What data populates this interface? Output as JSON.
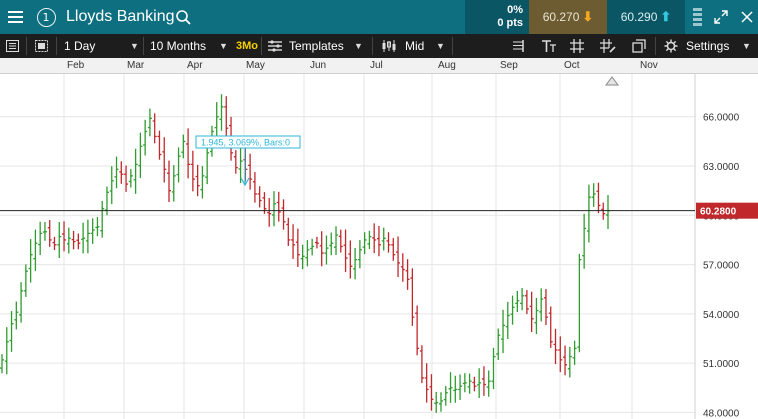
{
  "header": {
    "window_number": "1",
    "instrument_name": "Lloyds Banking",
    "change_percent": "0%",
    "change_points": "0 pts",
    "sell_price": "60.270",
    "buy_price": "60.290"
  },
  "toolbar": {
    "interval": "1 Day",
    "range": "10 Months",
    "preset_3mo": "3Mo",
    "templates": "Templates",
    "price_type": "Mid",
    "settings": "Settings"
  },
  "icons": {
    "menu": "menu-icon",
    "window_number": "circle-number-icon",
    "search": "search-icon",
    "sell_arrow": "arrow-down-icon",
    "buy_arrow": "arrow-up-icon",
    "drag": "grip-icon",
    "expand": "expand-icon",
    "close": "close-icon",
    "panel": "panel-icon",
    "layout": "layout-icon",
    "templates": "chart-tools-icon",
    "candles": "candles-icon",
    "trendline": "drawing-icon",
    "text": "text-icon",
    "crosshair": "crosshair-icon",
    "drawing_tools": "drawing-tools-icon",
    "popout": "popout-icon",
    "settings": "gear-icon"
  },
  "colors": {
    "header_bg": "#0e6f80",
    "sell_bg": "#6d5b32",
    "buy_bg": "#0b5665",
    "up_bar": "#2e9c2e",
    "down_bar": "#c0282b",
    "measure": "#2cb7d9",
    "price_label_bg": "#c0282b"
  },
  "chart_data": {
    "type": "ohlc",
    "x_axis_months": [
      "Feb",
      "Mar",
      "Apr",
      "May",
      "Jun",
      "Jul",
      "Aug",
      "Sep",
      "Oct",
      "Nov"
    ],
    "y_ticks": [
      "66.0000",
      "63.0000",
      "60.0000",
      "57.0000",
      "54.0000",
      "51.0000",
      "48.0000"
    ],
    "ylim": [
      47.6,
      68.6
    ],
    "current_price_label": "60.2800",
    "current_price": 60.28,
    "measure_label": "1.945, 3.069%, Bars:0",
    "closes": [
      51.2,
      52.3,
      53.4,
      54.1,
      55.4,
      56.6,
      57.6,
      58.3,
      58.9,
      59.0,
      58.5,
      58.2,
      58.7,
      58.5,
      58.6,
      58.4,
      58.3,
      58.6,
      58.9,
      59.1,
      59.3,
      60.4,
      61.4,
      62.1,
      62.8,
      62.5,
      61.9,
      62.4,
      63.1,
      64.2,
      65.1,
      65.9,
      64.8,
      63.7,
      62.8,
      61.5,
      62.4,
      63.6,
      64.5,
      63.1,
      62.2,
      61.8,
      62.4,
      63.8,
      65.1,
      66.0,
      66.6,
      65.3,
      63.8,
      62.9,
      63.3,
      62.8,
      62.2,
      61.3,
      60.9,
      60.4,
      60.1,
      60.7,
      60.2,
      59.6,
      58.5,
      58.2,
      57.6,
      57.5,
      57.9,
      58.1,
      58.3,
      57.7,
      58.0,
      58.3,
      58.8,
      58.1,
      57.4,
      56.9,
      57.3,
      57.9,
      58.5,
      58.7,
      58.5,
      58.2,
      58.6,
      58.2,
      57.6,
      57.1,
      56.7,
      56.1,
      53.8,
      51.9,
      50.1,
      49.4,
      48.8,
      48.6,
      48.7,
      49.2,
      49.5,
      49.4,
      49.6,
      49.8,
      49.9,
      49.6,
      49.8,
      49.7,
      49.9,
      51.4,
      52.7,
      53.3,
      53.9,
      54.4,
      54.8,
      55.1,
      54.3,
      53.7,
      54.2,
      54.9,
      53.8,
      52.3,
      51.8,
      51.2,
      50.9,
      51.4,
      51.9,
      57.3,
      59.2,
      61.1,
      61.3,
      60.6,
      60.1,
      60.28
    ]
  }
}
